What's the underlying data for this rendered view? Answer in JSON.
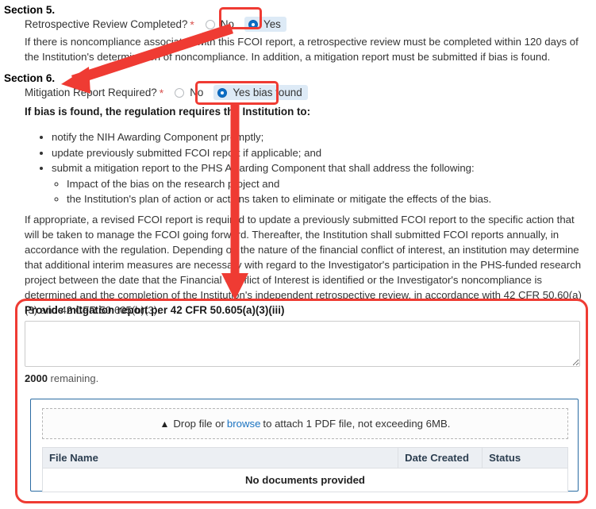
{
  "sections": {
    "section5": {
      "heading": "Section 5.",
      "question": "Retrospective Review Completed?",
      "required_marker": "*",
      "options": [
        {
          "label": "No",
          "selected": false
        },
        {
          "label": "Yes",
          "selected": true
        }
      ],
      "paragraph": "If there is noncompliance associated with this FCOI report, a retrospective review must be completed within 120 days of the Institution's determination of noncompliance. In addition, a mitigation report must be submitted if bias is found."
    },
    "section6": {
      "heading": "Section 6.",
      "question": "Mitigation Report Required?",
      "required_marker": "*",
      "options": [
        {
          "label": "No",
          "selected": false
        },
        {
          "label": "Yes bias found",
          "selected": true
        }
      ],
      "bias_lead": "If bias is found, the regulation requires the Institution to:",
      "bullets": [
        "notify the NIH Awarding Component promptly;",
        "update previously submitted FCOI report if applicable; and",
        "submit a mitigation report to the PHS Awarding Component that shall address the following:"
      ],
      "sub_bullets": [
        "Impact of the bias on the research project and",
        "the Institution's plan of action or actions taken to eliminate or mitigate the effects of the bias."
      ],
      "long_paragraph": "If appropriate, a revised FCOI report is required to update a previously submitted FCOI report to the specific action that will be taken to manage the FCOI going forward. Thereafter, the Institution shall submitted FCOI reports annually, in accordance with the regulation. Depending on the nature of the financial conflict of interest, an institution may determine that additional interim measures are necessary with regard to the Investigator's participation in the PHS-funded research project between the date that the Financial Conflict of Interest is identified or the Investigator's noncompliance is determined and the completion of the Institution's independent retrospective review, in accordance with 42 CFR 50.60(a)(3) and 42 CFR 50.605(b)(3)."
    }
  },
  "mitigation_panel": {
    "title": "Provide mitgation report per 42 CFR 50.605(a)(3)(iii)",
    "textarea_value": "",
    "textarea_placeholder": "",
    "remaining_count": "2000",
    "remaining_suffix": " remaining.",
    "dropzone": {
      "icon": "upload-icon",
      "prefix": "Drop file or ",
      "link": "browse",
      "suffix": " to attach 1 PDF file, not exceeding 6MB."
    },
    "table": {
      "headers": [
        "File Name",
        "Date Created",
        "Status"
      ],
      "empty_message": "No documents provided",
      "rows": []
    }
  },
  "annotations": {
    "color": "#ef3b33",
    "highlight_boxes": [
      "yes-radio-section5",
      "yes-bias-found-radio-section6",
      "mitigation-panel"
    ],
    "arrows": [
      {
        "name": "arrow-to-section6",
        "from": "yes-radio-section5",
        "to": "section6-heading"
      },
      {
        "name": "arrow-to-mitigation-panel",
        "from": "yes-bias-found-radio-section6",
        "to": "mitigation-panel"
      }
    ]
  },
  "colors": {
    "accent_red": "#ef3b33",
    "radio_selected_blue": "#0d6ec4",
    "radio_highlight_bg": "#ddeaf6",
    "link_blue": "#1a73c1",
    "panel_border_blue": "#2b6ca3",
    "required_star": "#d9534f",
    "table_header_bg": "#eceff3"
  }
}
